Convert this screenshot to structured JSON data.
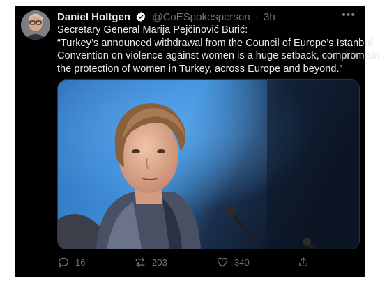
{
  "tweet": {
    "author_name": "Daniel Holtgen",
    "handle": "@CoESpokesperson",
    "separator": "·",
    "time": "3h",
    "more_icon": "more-dots-icon",
    "verified_icon": "verified-badge-icon",
    "lines": [
      "Secretary General Marija Pejčinović Burić:",
      "“Turkey’s announced withdrawal from the Council of Europe’s Istanbul",
      "Convention on violence against women is a huge setback, compromising",
      "the protection of women in Turkey, across Europe and beyond.”"
    ],
    "replies": "16",
    "retweets": "203",
    "likes": "340"
  },
  "colors": {
    "background": "#000000",
    "text": "#e7e9ea",
    "muted": "#71767b",
    "verified": "#ffffff"
  }
}
